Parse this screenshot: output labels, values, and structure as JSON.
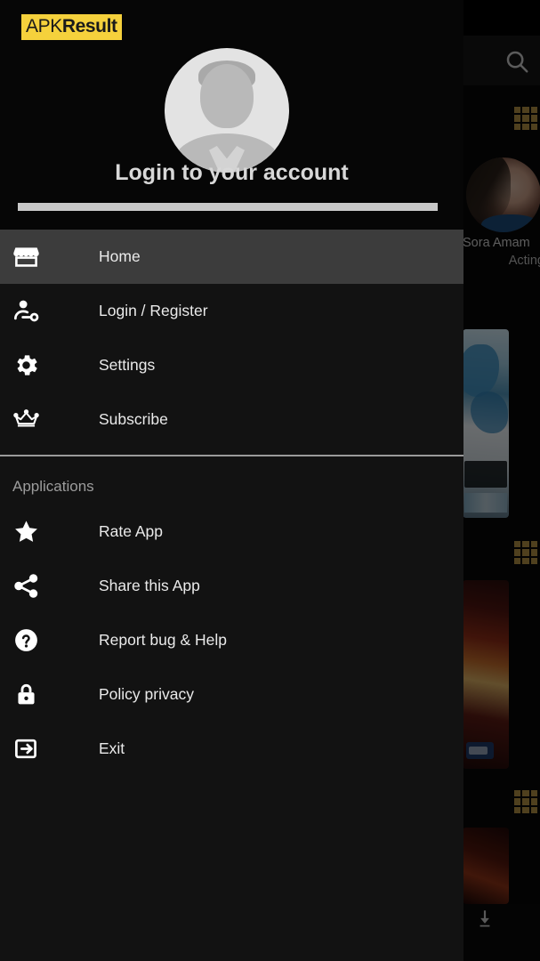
{
  "watermark": {
    "prefix": "APK",
    "bold": "Result"
  },
  "background_app": {
    "search_icon": "search-icon",
    "download_icon": "download-icon",
    "profile": {
      "name": "Sora Amam",
      "role": "Acting"
    },
    "grid_icon": "grid-icon",
    "accent_color": "#b08f43"
  },
  "drawer": {
    "header": {
      "avatar_icon": "default-user-avatar",
      "title": "Login to your account"
    },
    "primary_items": [
      {
        "label": "Home",
        "icon": "store-icon",
        "selected": true
      },
      {
        "label": "Login / Register",
        "icon": "account-key-icon",
        "selected": false
      },
      {
        "label": "Settings",
        "icon": "gear-icon",
        "selected": false
      },
      {
        "label": "Subscribe",
        "icon": "crown-icon",
        "selected": false
      }
    ],
    "section_title": "Applications",
    "secondary_items": [
      {
        "label": "Rate App",
        "icon": "star-icon"
      },
      {
        "label": "Share this App",
        "icon": "share-icon"
      },
      {
        "label": "Report bug & Help",
        "icon": "help-circle-icon"
      },
      {
        "label": "Policy privacy",
        "icon": "lock-icon"
      },
      {
        "label": "Exit",
        "icon": "exit-icon"
      }
    ],
    "colors": {
      "background": "#121212",
      "header_background": "#060606",
      "selected_item": "#3c3c3c",
      "divider": "#9a9a9a",
      "label_text": "#eaeaea",
      "section_text": "#9c9c9c",
      "highlight_bar": "#c8c8c8",
      "watermark_background": "#f5d13c"
    }
  }
}
